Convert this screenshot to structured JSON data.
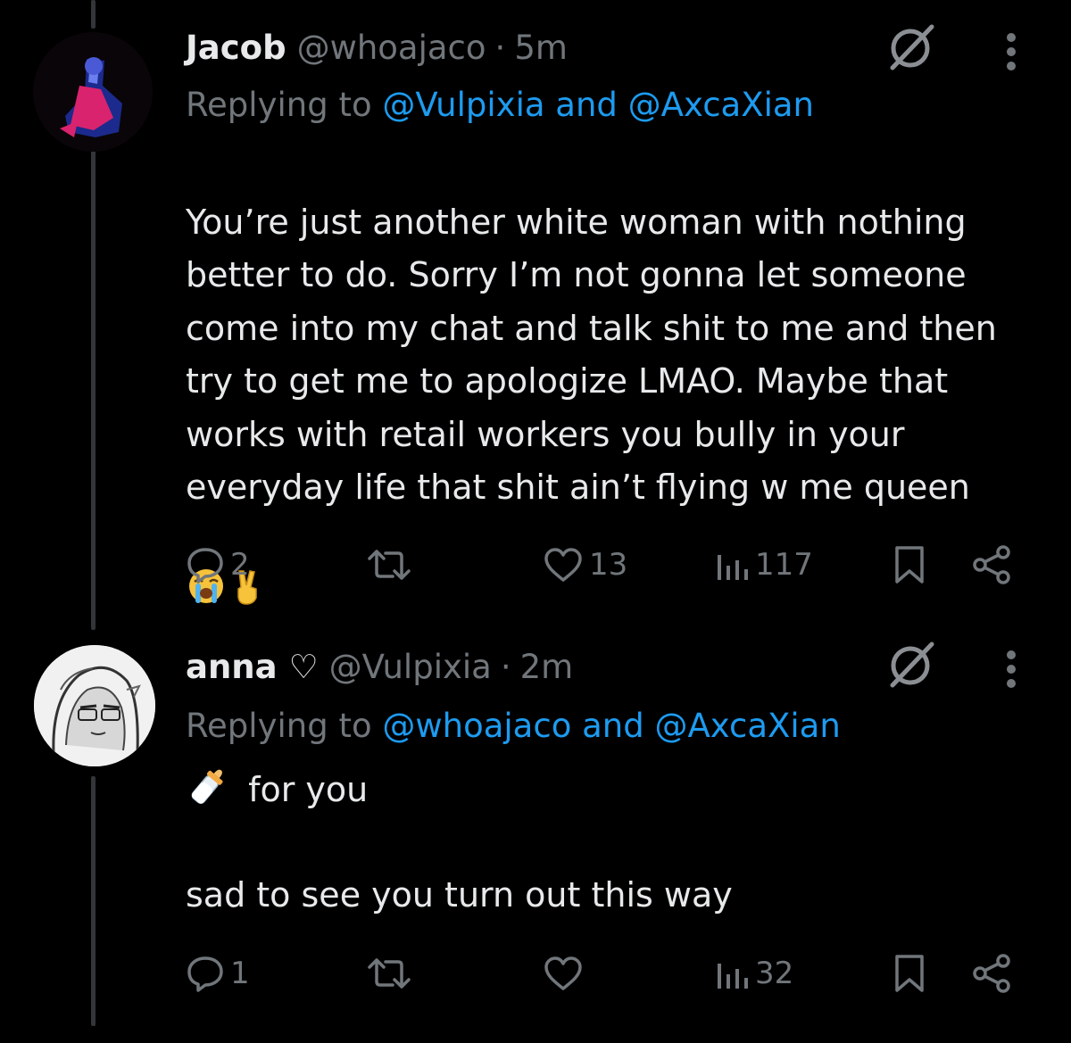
{
  "tweets": [
    {
      "display_name": "Jacob",
      "handle": "@whoajaco",
      "time": "5m",
      "reply_prefix": "Replying to",
      "reply_mentions": "@Vulpixia and @AxcaXian",
      "body": "You’re just another white woman with nothing better to do. Sorry I’m not gonna let someone come into my chat and talk shit to me and then try to get me to apologize LMAO. Maybe that works with retail workers you bully in your everyday life that shit ain’t flying w me queen",
      "emojis": [
        "loudly-crying-face",
        "victory-hand"
      ],
      "stats": {
        "replies": "2",
        "reposts": "",
        "likes": "13",
        "views": "117"
      }
    },
    {
      "display_name": "anna ♡",
      "handle": "@Vulpixia",
      "time": "2m",
      "reply_prefix": "Replying to",
      "reply_mentions": "@whoajaco and @AxcaXian",
      "body_line1": "for you",
      "body_line2": "sad to see you turn out this way",
      "emoji": "baby-bottle",
      "stats": {
        "replies": "1",
        "reposts": "",
        "likes": "",
        "views": "32"
      }
    }
  ],
  "colors": {
    "background": "#000000",
    "text": "#e7e9ea",
    "muted": "#71767b",
    "accent": "#1d9bf0"
  },
  "icons": [
    "grok-icon",
    "more-icon",
    "reply-icon",
    "repost-icon",
    "like-icon",
    "views-icon",
    "bookmark-icon",
    "share-icon"
  ]
}
